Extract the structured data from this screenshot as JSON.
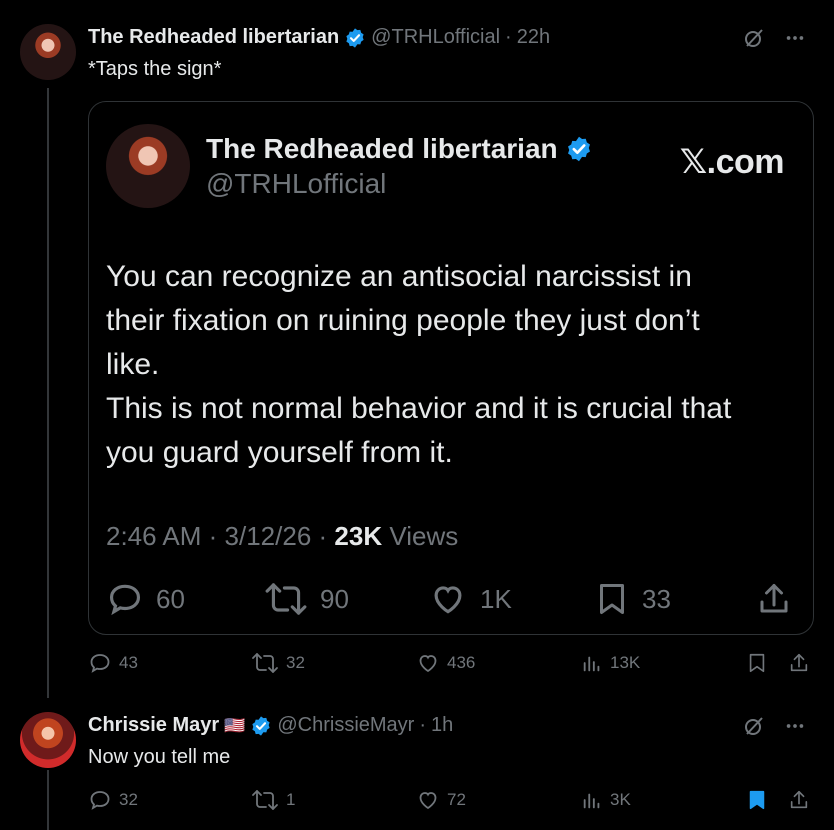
{
  "tweet1": {
    "name": "The Redheaded libertarian",
    "handle": "@TRHLofficial",
    "time": "22h",
    "text": "*Taps the sign*",
    "quote_card": {
      "name": "The Redheaded libertarian",
      "handle": "@TRHLofficial",
      "brand": "𝕏.com",
      "body_lines": [
        "You can recognize an antisocial narcissist in",
        "their fixation on ruining people they just don’t",
        "like.",
        "This is not normal behavior and it is crucial that",
        "you guard yourself from it."
      ],
      "time": "2:46 AM",
      "date": "3/12/26",
      "views_count": "23K",
      "views_label": "Views",
      "replies": "60",
      "reposts": "90",
      "likes": "1K",
      "bookmarks": "33"
    },
    "replies": "43",
    "reposts": "32",
    "likes": "436",
    "views": "13K"
  },
  "tweet2": {
    "name": "Chrissie Mayr",
    "flag": "🇺🇸",
    "handle": "@ChrissieMayr",
    "time": "1h",
    "text": "Now you tell me",
    "replies": "32",
    "reposts": "1",
    "likes": "72",
    "views": "3K"
  },
  "colors": {
    "background": "#000000",
    "text": "#e7e9ea",
    "muted": "#71767b",
    "verified": "#1d9bf0",
    "border": "#2f3336"
  }
}
